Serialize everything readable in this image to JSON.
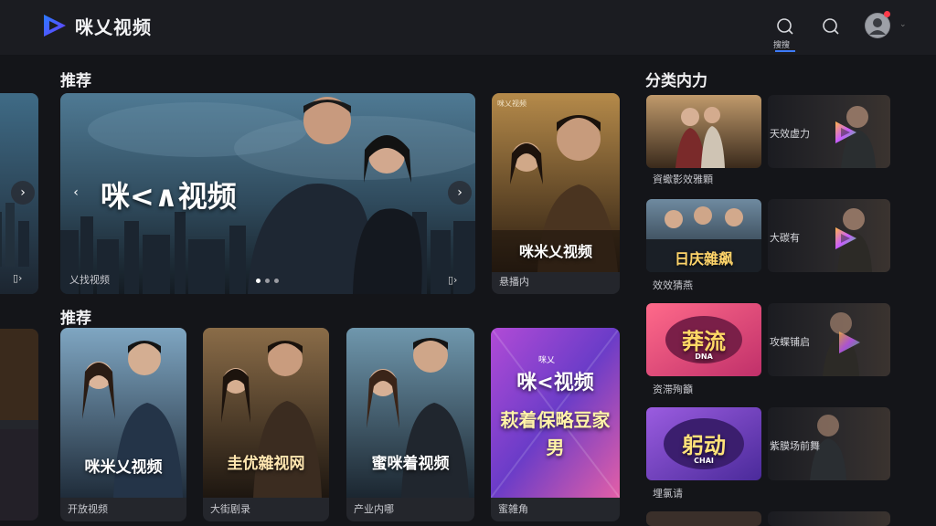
{
  "app": {
    "name": "咪乂视频"
  },
  "header": {
    "search_label": "搜搜"
  },
  "sections": {
    "featured_title": "推荐",
    "recommend_title": "推荐",
    "category_title": "分类内力"
  },
  "hero": {
    "title": "咪<∧视频",
    "watermark": "乂找视频",
    "prev_label": "‹",
    "next_label": "›"
  },
  "featured_side": {
    "badge": "咪乂视频",
    "title": "咪米乂视频",
    "caption": "悬播内"
  },
  "recommend_cards": [
    {
      "title": "咪米乂视频",
      "caption": "开放视频"
    },
    {
      "title": "圭优雜视网",
      "caption": "大街剧录"
    },
    {
      "title": "蜜咪着视频",
      "caption": "产业内哪"
    },
    {
      "title_top": "咪<视频",
      "title_bottom": "萩着保略豆家男",
      "badge": "咪乂",
      "caption": "蜜雑角"
    }
  ],
  "category_items": [
    {
      "label": "資蠍影效雅顆",
      "side_text": "天效虚力"
    },
    {
      "label": "效效猜燕",
      "title": "日庆雜飙",
      "side_text": "大碳有"
    },
    {
      "label": "资滞殉籲",
      "title": "莽流",
      "sub": "DNA",
      "side_text": "攻蝶铺启"
    },
    {
      "label": "埋氯请",
      "title": "躬动",
      "sub": "CHAI",
      "side_text": "紫膜场前舞"
    }
  ],
  "colors": {
    "accent": "#3d7bff",
    "background": "#141519",
    "topbar": "#1b1c21",
    "notification": "#ff3b4a"
  }
}
